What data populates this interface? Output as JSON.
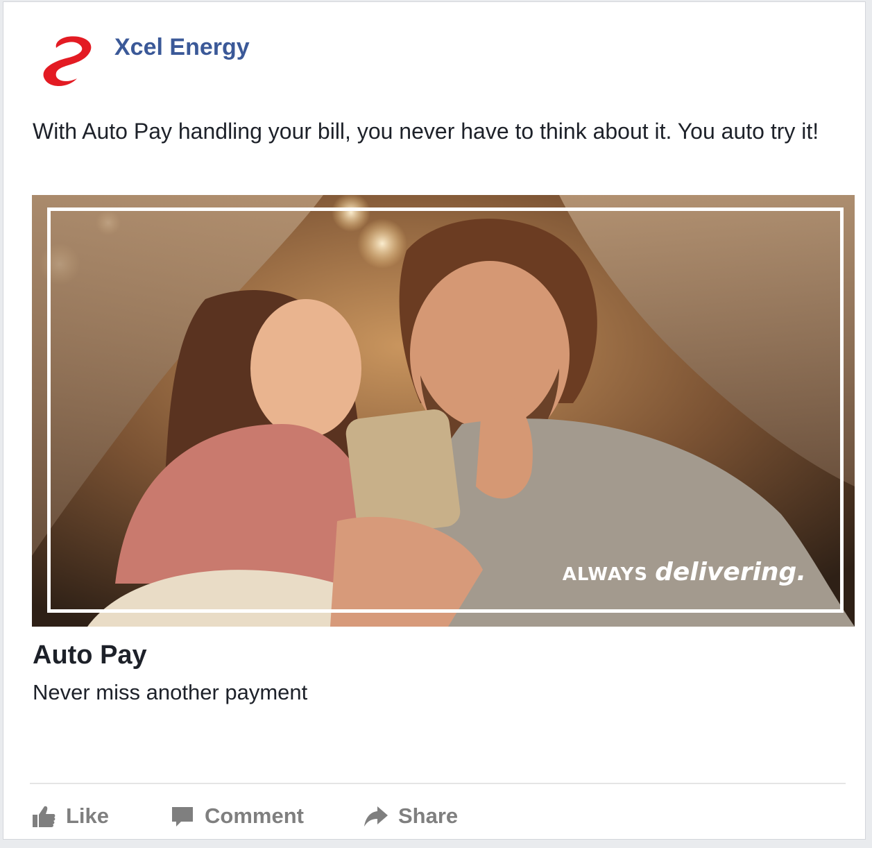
{
  "post": {
    "page_name": "Xcel Energy",
    "logo_icon": "xcel-energy-swirl-logo",
    "text": "With Auto Pay handling your bill, you never have to think about it. You auto try it!"
  },
  "hero": {
    "tagline_prefix": "ALWAYS",
    "tagline_suffix": "delivering."
  },
  "link": {
    "title": "Auto Pay",
    "description": "Never miss another payment"
  },
  "actions": [
    {
      "label": "Like",
      "icon": "thumbs-up-icon"
    },
    {
      "label": "Comment",
      "icon": "comment-icon"
    },
    {
      "label": "Share",
      "icon": "share-icon"
    }
  ],
  "colors": {
    "brand_blue": "#3b5998",
    "logo_red": "#e31b23",
    "action_gray": "#7f7f7f",
    "text": "#1d2129"
  }
}
